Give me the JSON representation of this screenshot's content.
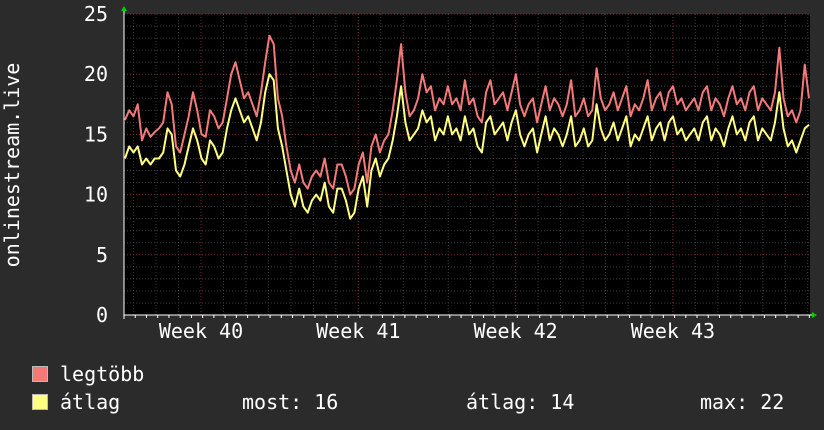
{
  "chart_data": {
    "type": "line",
    "ylabel": "onlinestream.live",
    "ylim": [
      0,
      25
    ],
    "yticks": [
      0,
      5,
      10,
      15,
      20,
      25
    ],
    "x_tick_labels": [
      "Week 40",
      "Week 41",
      "Week 42",
      "Week 43"
    ],
    "grid": true,
    "background": "#000000",
    "series": [
      {
        "name": "legtöbb",
        "color": "#f47a7a",
        "values": [
          16.2,
          17,
          16.5,
          17.5,
          14.5,
          15.5,
          14.8,
          15.2,
          15.5,
          16,
          18.5,
          17.5,
          14,
          13.5,
          15,
          16.5,
          18.5,
          17,
          15,
          14.8,
          17,
          16.5,
          15.5,
          16,
          18,
          20,
          21,
          19.5,
          18,
          18.5,
          17.5,
          16.5,
          18.5,
          21,
          23.2,
          22.5,
          18,
          16.5,
          14,
          12,
          11,
          12.5,
          11,
          10.5,
          11.5,
          12,
          11.5,
          13,
          11,
          10.5,
          12.5,
          12.5,
          11.5,
          10,
          10.5,
          12.5,
          13.5,
          11,
          14,
          15,
          13.5,
          14.5,
          15,
          17,
          19.5,
          22.5,
          18.5,
          16.5,
          17,
          18,
          20,
          18.5,
          19,
          17,
          18,
          17.5,
          19,
          17.5,
          18,
          17,
          19.5,
          17.5,
          18,
          16.5,
          16,
          18.5,
          19.5,
          17.5,
          18,
          18.5,
          17,
          18.5,
          20,
          17.5,
          16.5,
          17.5,
          18,
          16,
          17.5,
          19,
          17,
          18,
          17.5,
          16.5,
          17.5,
          19.5,
          16.5,
          17,
          18,
          16.5,
          17,
          20.5,
          18,
          17,
          17.5,
          18.5,
          17,
          18,
          19,
          16.5,
          17.5,
          17,
          18,
          19.5,
          17,
          18,
          18.5,
          17,
          18.5,
          19,
          17.5,
          18,
          17,
          17.5,
          18,
          17,
          18.5,
          19,
          17,
          18,
          17.5,
          16.5,
          18,
          19,
          17.5,
          18,
          17,
          18.5,
          19,
          17,
          18,
          17.5,
          17,
          18.5,
          22.2,
          18,
          16.5,
          17,
          16,
          17,
          20.8,
          18
        ]
      },
      {
        "name": "átlag",
        "color": "#ffff80",
        "values": [
          13,
          14,
          13.5,
          14,
          12.5,
          13,
          12.5,
          13,
          13,
          13.5,
          15.5,
          15,
          12,
          11.5,
          12.5,
          14,
          15.5,
          14.5,
          13,
          12.5,
          14.5,
          14,
          13,
          13.5,
          15.5,
          17,
          18,
          17,
          16,
          16.5,
          15.5,
          14.5,
          16,
          18.5,
          20,
          19.5,
          15.5,
          14,
          12,
          10,
          9,
          10.5,
          9,
          8.5,
          9.5,
          10,
          9.5,
          11,
          9,
          8.5,
          10.5,
          10.5,
          9.5,
          8,
          8.5,
          10.5,
          11.5,
          9,
          12,
          13,
          11.5,
          12.5,
          13,
          14.5,
          16.5,
          19,
          16,
          14.5,
          15,
          15.5,
          17,
          16,
          16.5,
          14.5,
          15.5,
          15,
          16.5,
          15,
          15.5,
          14.5,
          16.5,
          15,
          15.5,
          14,
          13.5,
          16,
          16.5,
          15,
          15.5,
          16,
          14.5,
          16,
          17,
          15,
          14,
          15,
          15.5,
          13.5,
          15,
          16.5,
          14.5,
          15.5,
          15,
          14,
          15,
          16.5,
          14,
          14.5,
          15.5,
          14,
          14.5,
          17.5,
          15.5,
          14.5,
          15,
          16,
          14.5,
          15.5,
          16.5,
          14,
          15,
          14.5,
          15.5,
          16.5,
          14.5,
          15.5,
          16,
          14.5,
          16,
          16.5,
          15,
          15.5,
          14.5,
          15,
          15.5,
          14.5,
          16,
          16.5,
          14.5,
          15.5,
          15,
          14,
          15.5,
          16.5,
          15,
          15.5,
          14.5,
          16,
          16.5,
          14.5,
          15.5,
          15,
          14.5,
          16,
          18.5,
          15.5,
          14,
          14.5,
          13.5,
          14.5,
          15.5,
          15.8
        ]
      }
    ]
  },
  "legend": {
    "max_label": "legtöbb",
    "avg_label": "átlag",
    "stat_now": "most: 16",
    "stat_avg": "átlag: 14",
    "stat_max": "max: 22"
  }
}
